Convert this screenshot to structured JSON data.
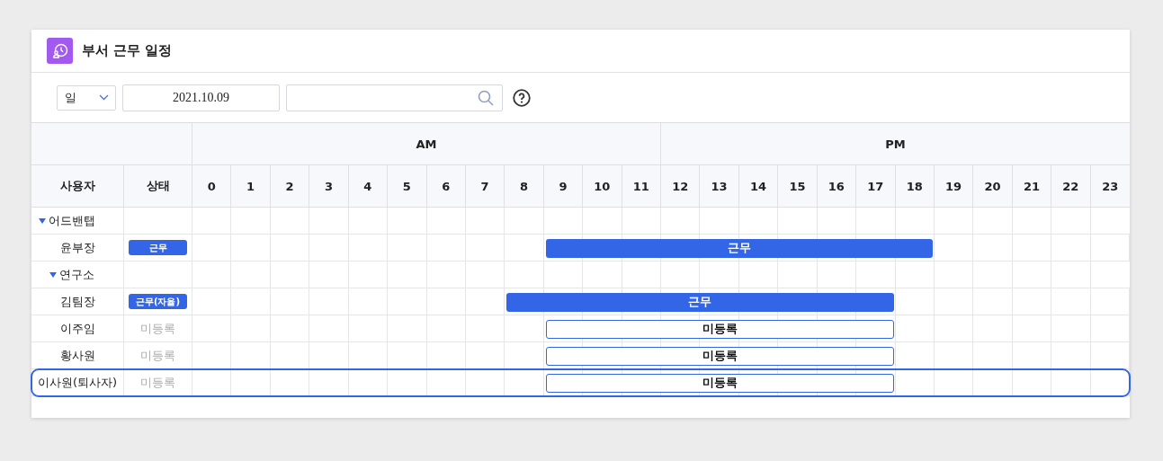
{
  "window": {
    "title": "부서 근무 일정"
  },
  "toolbar": {
    "period_select": {
      "value": "일"
    },
    "date_field": {
      "value": "2021.10.09"
    }
  },
  "table": {
    "periods": [
      {
        "label": "AM"
      },
      {
        "label": "PM"
      }
    ],
    "columns": [
      "사용자",
      "상태"
    ],
    "hours": [
      "0",
      "1",
      "2",
      "3",
      "4",
      "5",
      "6",
      "7",
      "8",
      "9",
      "10",
      "11",
      "12",
      "13",
      "14",
      "15",
      "16",
      "17",
      "18",
      "19",
      "20",
      "21",
      "22",
      "23"
    ],
    "rows": [
      {
        "kind": "group",
        "name": "어드밴탭",
        "expanded": true,
        "children": [
          {
            "kind": "person",
            "name": "윤부장",
            "selected": false,
            "status": {
              "kind": "work",
              "label": "근무"
            },
            "bar": {
              "kind": "work",
              "label": "근무",
              "hours": [
                false,
                false,
                false,
                false,
                false,
                false,
                false,
                false,
                false,
                true,
                true,
                true,
                true,
                true,
                true,
                true,
                true,
                true,
                true,
                false,
                false,
                false,
                false,
                false
              ]
            }
          },
          {
            "kind": "group",
            "name": "연구소",
            "expanded": true,
            "children": [
              {
                "kind": "person",
                "name": "김팀장",
                "selected": false,
                "status": {
                  "kind": "work",
                  "label": "근무(자율)"
                },
                "bar": {
                  "kind": "work",
                  "label": "근무",
                  "hours": [
                    false,
                    false,
                    false,
                    false,
                    false,
                    false,
                    false,
                    false,
                    true,
                    true,
                    true,
                    true,
                    true,
                    true,
                    true,
                    true,
                    true,
                    true,
                    false,
                    false,
                    false,
                    false,
                    false,
                    false
                  ]
                }
              },
              {
                "kind": "person",
                "name": "이주임",
                "selected": false,
                "status": {
                  "kind": "unregistered",
                  "label": "미등록"
                },
                "bar": {
                  "kind": "unregistered",
                  "label": "미등록",
                  "hours": [
                    false,
                    false,
                    false,
                    false,
                    false,
                    false,
                    false,
                    false,
                    false,
                    true,
                    true,
                    true,
                    true,
                    true,
                    true,
                    true,
                    true,
                    true,
                    false,
                    false,
                    false,
                    false,
                    false,
                    false
                  ]
                }
              },
              {
                "kind": "person",
                "name": "황사원",
                "selected": false,
                "status": {
                  "kind": "unregistered",
                  "label": "미등록"
                },
                "bar": {
                  "kind": "unregistered",
                  "label": "미등록",
                  "hours": [
                    false,
                    false,
                    false,
                    false,
                    false,
                    false,
                    false,
                    false,
                    false,
                    true,
                    true,
                    true,
                    true,
                    true,
                    true,
                    true,
                    true,
                    true,
                    false,
                    false,
                    false,
                    false,
                    false,
                    false
                  ]
                }
              },
              {
                "kind": "person",
                "name": "이사원(퇴사자)",
                "selected": true,
                "status": {
                  "kind": "unregistered",
                  "label": "미등록"
                },
                "bar": {
                  "kind": "unregistered",
                  "label": "미등록",
                  "hours": [
                    false,
                    false,
                    false,
                    false,
                    false,
                    false,
                    false,
                    false,
                    false,
                    true,
                    true,
                    true,
                    true,
                    true,
                    true,
                    true,
                    true,
                    true,
                    false,
                    false,
                    false,
                    false,
                    false,
                    false
                  ]
                }
              }
            ]
          }
        ]
      }
    ]
  }
}
